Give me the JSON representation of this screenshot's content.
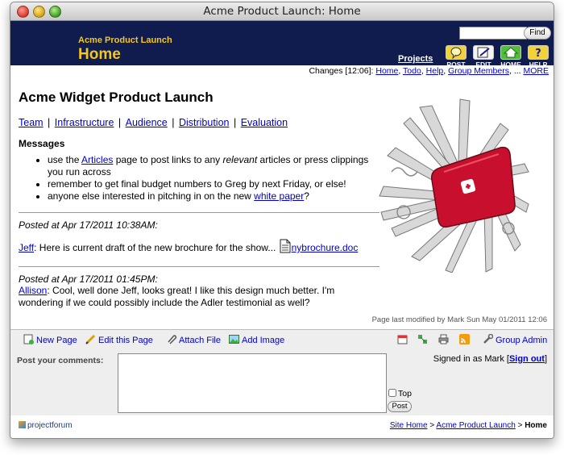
{
  "window": {
    "title": "Acme Product Launch: Home"
  },
  "header": {
    "app_name": "Acme Product Launch",
    "page_name": "Home",
    "search_placeholder": "",
    "find_label": "Find",
    "projects_label": "Projects",
    "icons": [
      {
        "label": "POST",
        "icon": "post-icon"
      },
      {
        "label": "EDIT",
        "icon": "edit-icon"
      },
      {
        "label": "HOME",
        "icon": "home-icon"
      },
      {
        "label": "HELP",
        "icon": "help-icon"
      }
    ]
  },
  "changes": {
    "prefix": "Changes [12:06]:",
    "links": [
      "Home",
      "Todo",
      "Help",
      "Group Members",
      "..."
    ],
    "more": "MORE"
  },
  "content": {
    "title": "Acme Widget Product Launch",
    "nav": [
      "Team",
      "Infrastructure",
      "Audience",
      "Distribution",
      "Evaluation"
    ],
    "messages_heading": "Messages",
    "bullets": {
      "b1_pre": "use the ",
      "b1_link": "Articles",
      "b1_mid": " page to post links to any ",
      "b1_em": "relevant",
      "b1_post": " articles or press clippings you run across",
      "b2": "remember to get final budget numbers to Greg by next Friday, or else!",
      "b3_pre": "anyone else interested in pitching in on the new ",
      "b3_link": "white paper",
      "b3_post": "?"
    },
    "posts": [
      {
        "posted": "Posted at Apr 17/2011 10:38AM:",
        "author": "Jeff",
        "text": ": Here is current draft of the new brochure for the show...",
        "attachment": "nybrochure.doc"
      },
      {
        "posted": "Posted at Apr 17/2011 01:45PM:",
        "author": "Allison",
        "text": ": Cool, well done Jeff, looks great! I like this design much better. I'm wondering if we could possibly include the Adler testimonial as well?"
      }
    ],
    "last_modified": "Page last modified by Mark Sun May 01/2011 12:06"
  },
  "toolbar": {
    "new_page": "New Page",
    "edit_page": "Edit this Page",
    "attach_file": "Attach File",
    "add_image": "Add Image",
    "group_admin": "Group Admin"
  },
  "comments": {
    "label": "Post your comments:",
    "signed_prefix": "Signed in as Mark [",
    "sign_out": "Sign out",
    "signed_suffix": "]",
    "top_label": "Top",
    "post_label": "Post"
  },
  "footer": {
    "logo": "projectforum",
    "crumbs": [
      "Site Home",
      "Acme Product Launch",
      "Home"
    ],
    "sep": " > "
  },
  "colors": {
    "header_bg": "#0f1c4d",
    "header_text": "#f3c623",
    "link": "#0000cc"
  }
}
